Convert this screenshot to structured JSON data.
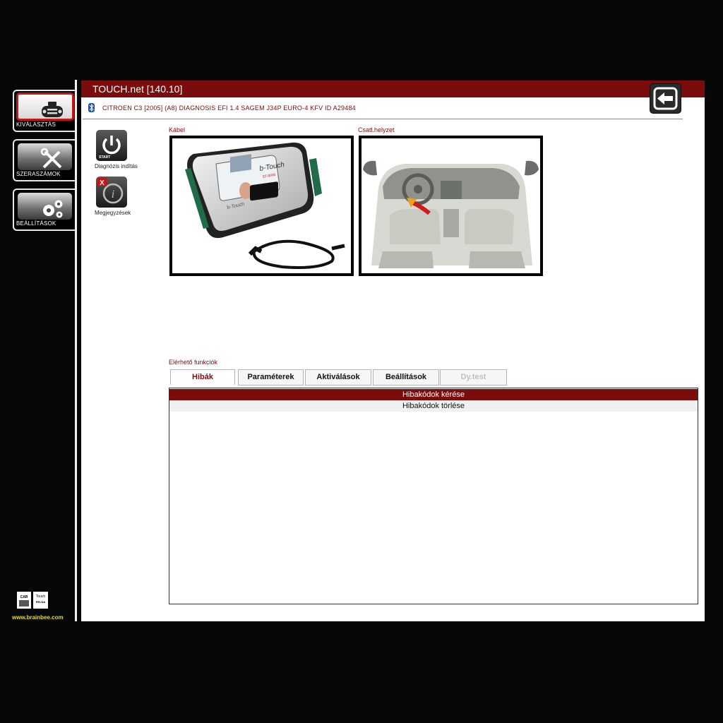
{
  "sidebar": {
    "items": [
      {
        "label": "KIVÁLASZTÁS",
        "icon": "obd-connector-icon",
        "active": true
      },
      {
        "label": "SZERASZÁMOK",
        "icon": "tools-icon",
        "active": false
      },
      {
        "label": "BEÁLLÍTÁSOK",
        "icon": "gears-icon",
        "active": false
      }
    ],
    "logo_car": "CAR",
    "logo_touch": "Touch",
    "logo_sub": "PELNA",
    "website": "www.brainbee.com"
  },
  "header": {
    "title": "TOUCH.net [140.10]",
    "exit_icon": "exit-icon",
    "vehicle_info": "CITROEN C3 [2005] (A8) DIAGNOSIS EFI 1.4 SAGEM J34P EURO-4 KFV ID A29484"
  },
  "tools": [
    {
      "label": "Diagnózis indítás",
      "icon": "power-start-icon",
      "badge": "START"
    },
    {
      "label": "Megjegyzések",
      "icon": "notes-info-icon",
      "badge": "X"
    }
  ],
  "images": {
    "cable_caption": "Kábel",
    "cable_image": "diagnostic-device-icon",
    "device_brand": "b-Touch",
    "device_model": "ST-9000",
    "position_caption": "Csatl.helyzet",
    "position_image": "car-interior-icon"
  },
  "functions": {
    "caption": "Elérhető funkciók",
    "tabs": [
      {
        "label": "Hibák",
        "state": "active"
      },
      {
        "label": "Paraméterek",
        "state": "normal"
      },
      {
        "label": "Aktiválások",
        "state": "normal"
      },
      {
        "label": "Beállítások",
        "state": "normal"
      },
      {
        "label": "Dy.test",
        "state": "disabled"
      }
    ],
    "items": [
      {
        "label": "Hibakódok kérése",
        "selected": true
      },
      {
        "label": "Hibakódok törlése",
        "selected": false
      }
    ]
  },
  "colors": {
    "accent": "#7a0c0c",
    "background": "#060808",
    "active_border": "#c01818",
    "website": "#f0dc1e"
  }
}
